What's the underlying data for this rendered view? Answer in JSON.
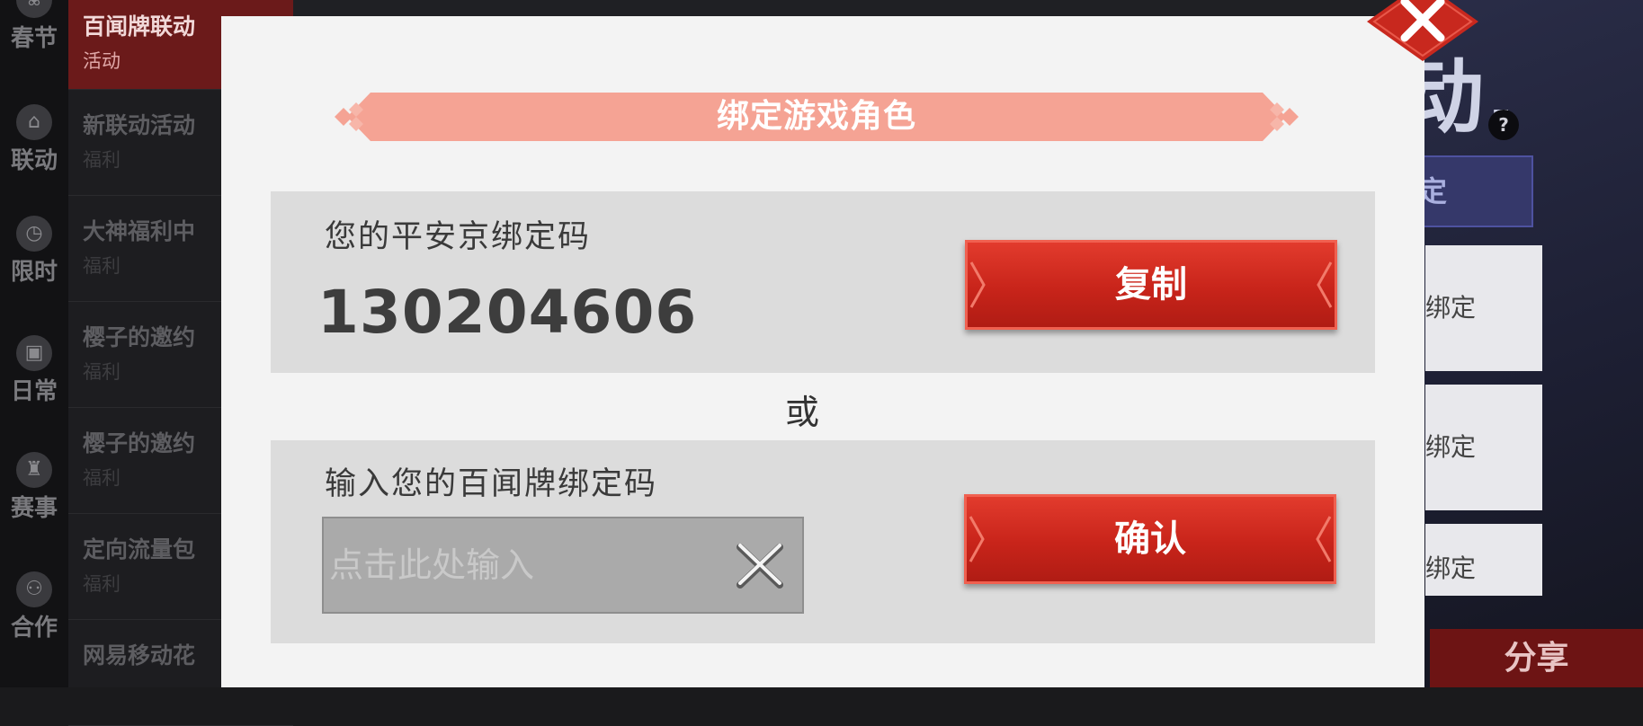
{
  "rail": {
    "items": [
      {
        "label": "春节",
        "icon": "spring-festival-icon"
      },
      {
        "label": "联动",
        "icon": "collab-icon"
      },
      {
        "label": "限时",
        "icon": "clock-icon"
      },
      {
        "label": "日常",
        "icon": "gift-icon"
      },
      {
        "label": "赛事",
        "icon": "trophy-icon"
      },
      {
        "label": "合作",
        "icon": "handshake-icon"
      }
    ]
  },
  "nav": {
    "items": [
      {
        "title": "百闻牌联动",
        "sub": "活动"
      },
      {
        "title": "新联动活动",
        "sub": "福利"
      },
      {
        "title": "大神福利中",
        "sub": "福利"
      },
      {
        "title": "樱子的邀约",
        "sub": "福利"
      },
      {
        "title": "樱子的邀约",
        "sub": "福利"
      },
      {
        "title": "定向流量包",
        "sub": "福利"
      },
      {
        "title": "网易移动花",
        "sub": ""
      }
    ]
  },
  "background": {
    "title_fragment": "动.",
    "help": "?",
    "bind_btn": "定",
    "cards": [
      "绑定",
      "绑定",
      "绑定"
    ],
    "share": "分享"
  },
  "dialog": {
    "title": "绑定游戏角色",
    "section1": {
      "label": "您的平安京绑定码",
      "code": "130204606",
      "button": "复制"
    },
    "or": "或",
    "section2": {
      "label": "输入您的百闻牌绑定码",
      "placeholder": "点击此处输入",
      "value": "",
      "button": "确认"
    }
  },
  "colors": {
    "accent_red": "#d42e22",
    "banner_pink": "#f5a394",
    "dialog_bg": "#f3f3f3",
    "section_bg": "#dcdcdc"
  }
}
